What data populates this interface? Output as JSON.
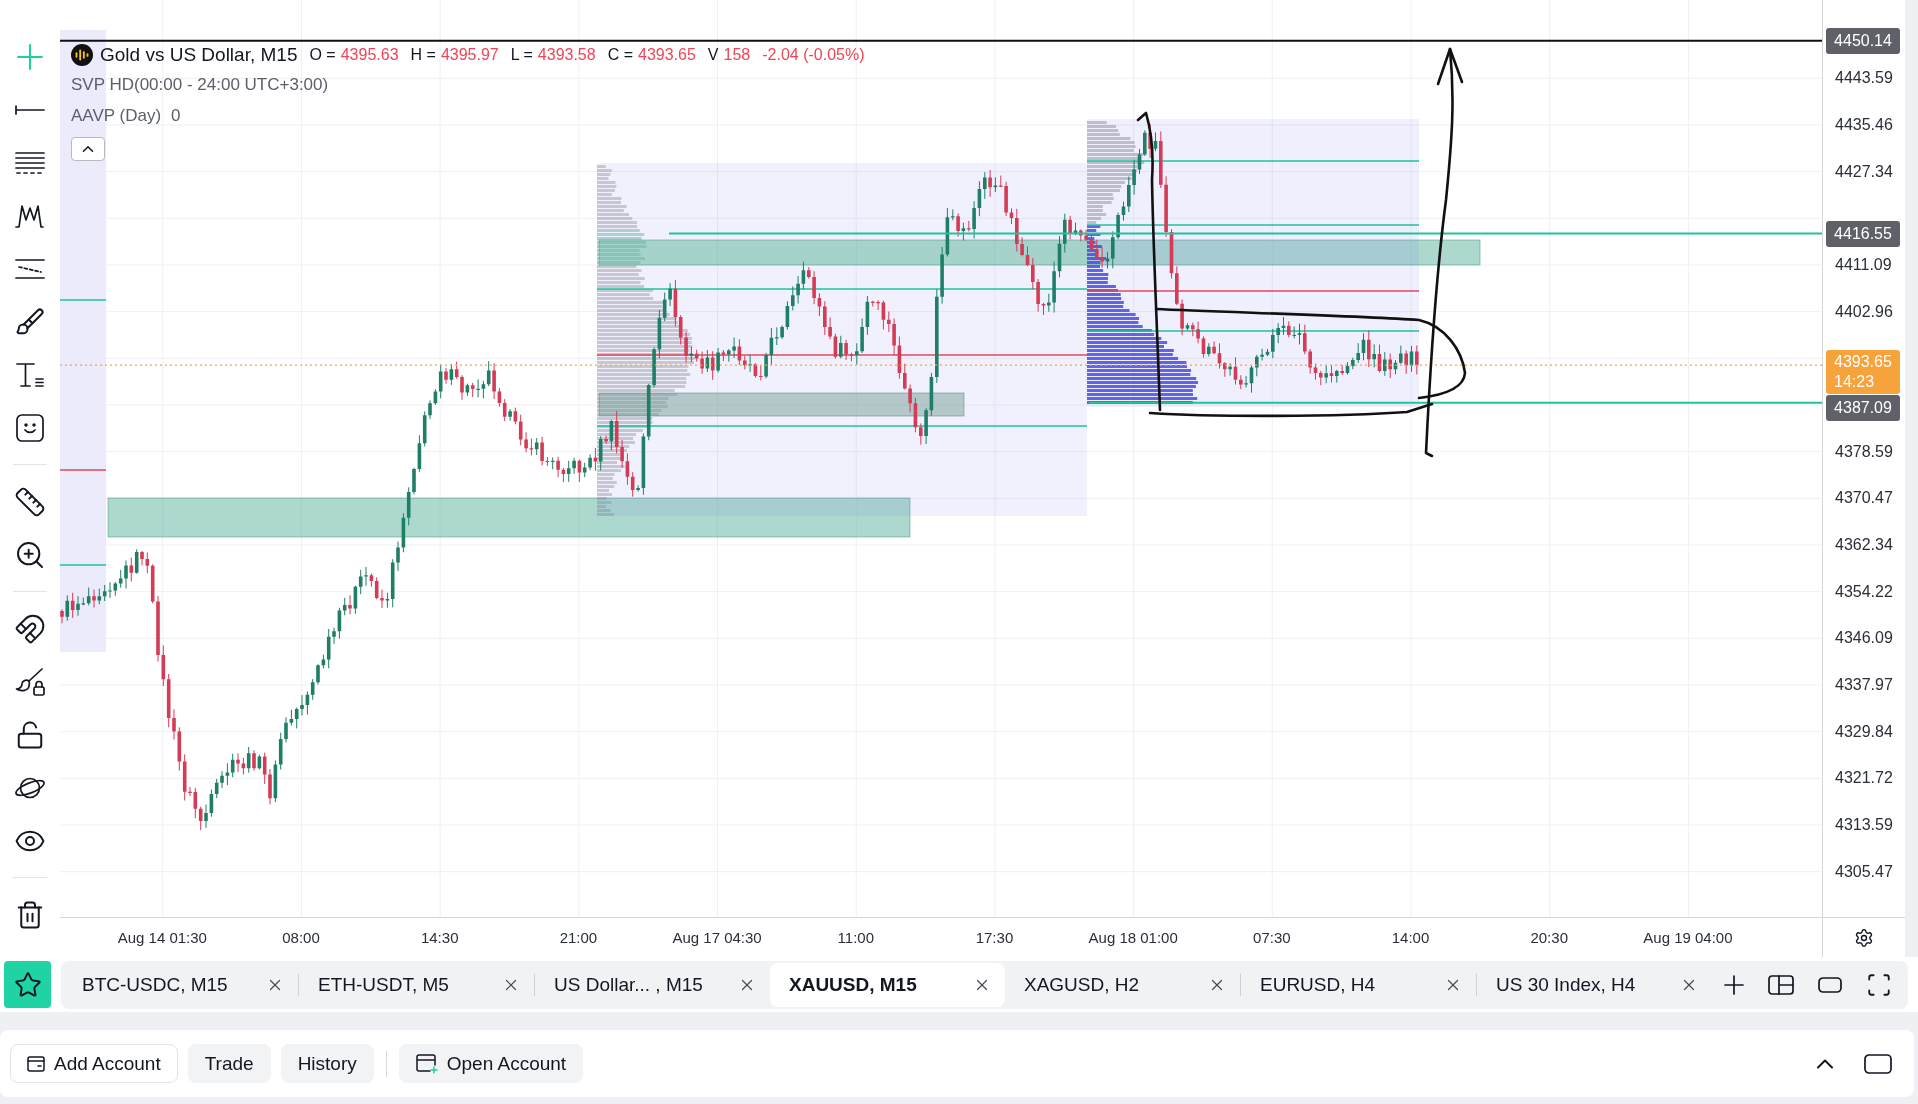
{
  "legend": {
    "symbol": "Gold vs US Dollar, M15",
    "negative": true,
    "quotes": [
      {
        "label": "O =",
        "value": "4395.63"
      },
      {
        "label": "H =",
        "value": "4395.97"
      },
      {
        "label": "L =",
        "value": "4393.58"
      },
      {
        "label": "C =",
        "value": "4393.65"
      },
      {
        "label": "V",
        "value": "158"
      }
    ],
    "change": "-2.04 (-0.05%)",
    "expanded": true,
    "indicators": [
      {
        "name": "SVP HD(00:00 - 24:00 UTC+3:00)"
      },
      {
        "name": "AAVP (Day)",
        "value": "0"
      }
    ]
  },
  "price_axis": {
    "labels": [
      "4443.59",
      "4435.46",
      "4427.34",
      "4411.09",
      "4402.96",
      "4378.59",
      "4370.47",
      "4362.34",
      "4354.22",
      "4346.09",
      "4337.97",
      "4329.84",
      "4321.72",
      "4313.59",
      "4305.47"
    ],
    "tags": [
      {
        "kind": "line",
        "value": "4450.14"
      },
      {
        "kind": "line",
        "value": "4416.55"
      },
      {
        "kind": "current",
        "value": "4393.65",
        "countdown": "14:23"
      },
      {
        "kind": "line",
        "value": "4387.09"
      }
    ]
  },
  "time_axis": {
    "labels": [
      "Aug 14 01:30",
      "08:00",
      "14:30",
      "21:00",
      "Aug 17 04:30",
      "11:00",
      "17:30",
      "Aug 18 01:00",
      "07:30",
      "14:00",
      "20:30",
      "Aug 19 04:00"
    ]
  },
  "tabs": [
    {
      "label": "BTC-USDC, M15",
      "selected": false
    },
    {
      "label": "ETH-USDT, M5",
      "selected": false
    },
    {
      "label": "US Dollar... , M15",
      "selected": false
    },
    {
      "label": "XAUUSD, M15",
      "selected": true
    },
    {
      "label": "XAGUSD, H2",
      "selected": false
    },
    {
      "label": "EURUSD, H4",
      "selected": false
    },
    {
      "label": "US 30 Index, H4",
      "selected": false
    }
  ],
  "account_bar": {
    "actions": [
      {
        "label": "Add Account",
        "kind": "add"
      },
      {
        "label": "Trade",
        "kind": "plain"
      },
      {
        "label": "History",
        "kind": "plain"
      }
    ],
    "open_account": "Open Account"
  }
}
